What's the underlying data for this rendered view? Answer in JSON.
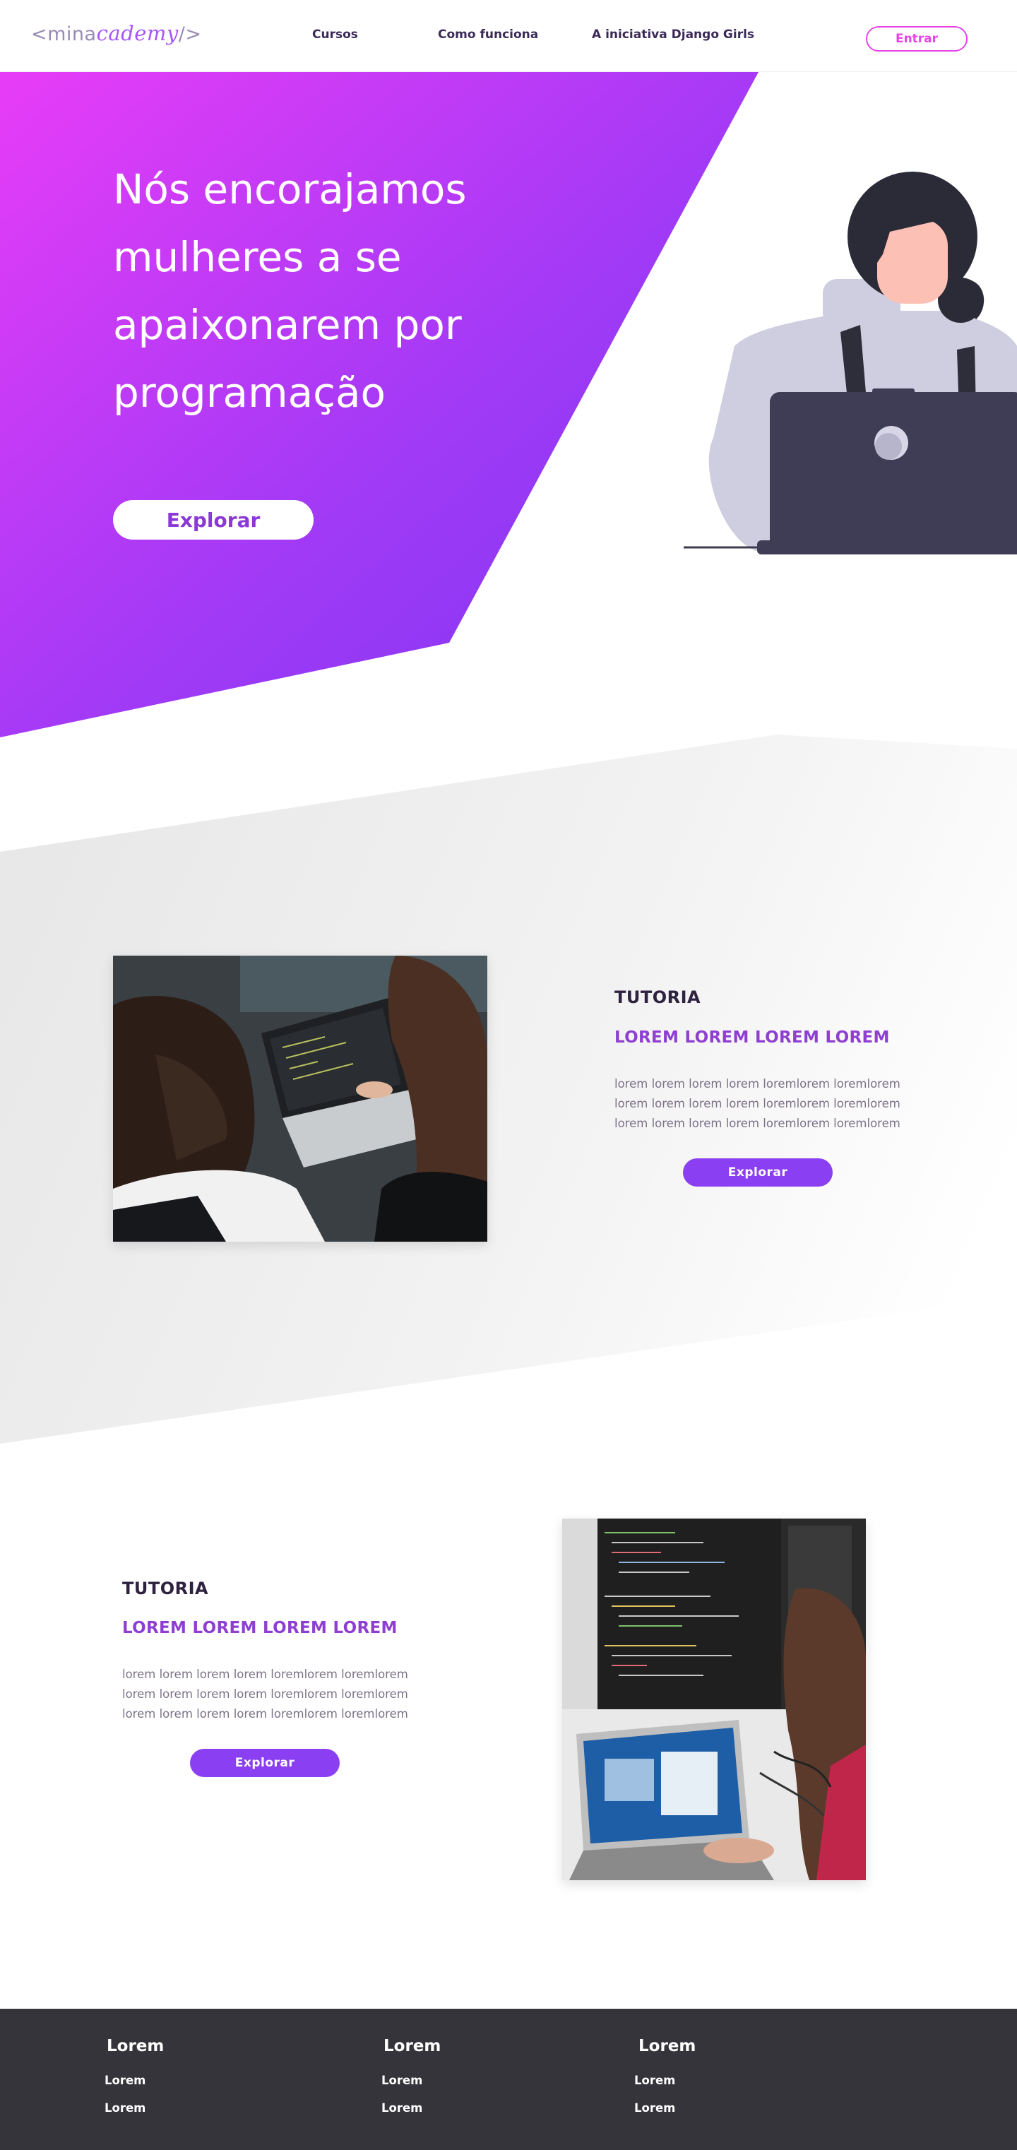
{
  "header": {
    "logo": {
      "prefix": "<mina",
      "middle": "cademy",
      "suffix": "/>"
    },
    "nav": [
      "Cursos",
      "Como funciona",
      "A iniciativa Django Girls"
    ],
    "login_label": "Entrar"
  },
  "hero": {
    "title_lines": [
      "Nós encorajamos",
      "mulheres a se",
      "apaixonarem por",
      "programação"
    ],
    "cta_label": "Explorar"
  },
  "sections": [
    {
      "label": "TUTORIA",
      "heading": "LOREM LOREM LOREM LOREM",
      "text_lines": [
        "lorem lorem lorem lorem loremlorem loremlorem",
        "lorem lorem lorem lorem loremlorem loremlorem",
        "lorem lorem lorem lorem loremlorem loremlorem"
      ],
      "button_label": "Explorar"
    },
    {
      "label": "TUTORIA",
      "heading": "LOREM LOREM LOREM LOREM",
      "text_lines": [
        "lorem lorem lorem lorem loremlorem loremlorem",
        "lorem lorem lorem lorem loremlorem loremlorem",
        "lorem lorem lorem lorem loremlorem loremlorem"
      ],
      "button_label": "Explorar"
    }
  ],
  "footer": {
    "columns": [
      {
        "title": "Lorem",
        "links": [
          "Lorem",
          "Lorem"
        ]
      },
      {
        "title": "Lorem",
        "links": [
          "Lorem",
          "Lorem"
        ]
      },
      {
        "title": "Lorem",
        "links": [
          "Lorem",
          "Lorem"
        ]
      }
    ]
  },
  "colors": {
    "accent_pink": "#e645e8",
    "accent_purple": "#8a3ff2",
    "heading_purple": "#8e3fd1",
    "footer_bg": "#36343b"
  }
}
